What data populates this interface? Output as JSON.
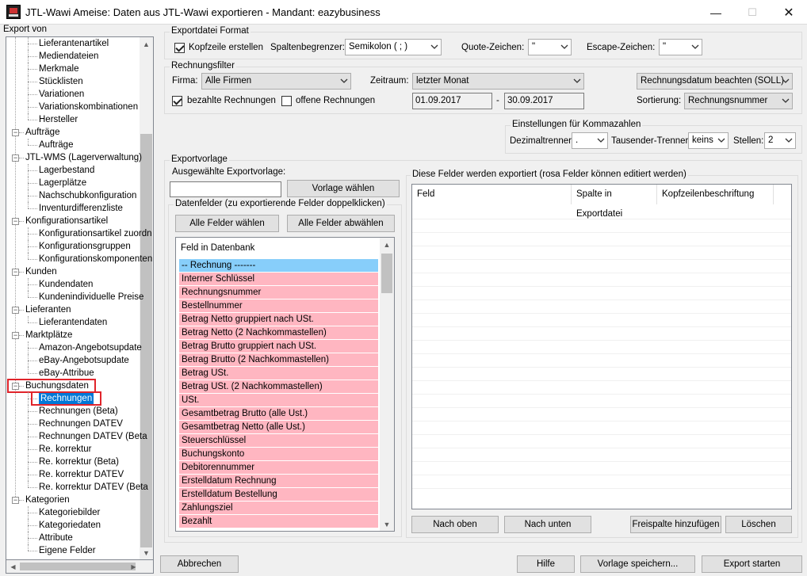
{
  "window": {
    "title": "JTL-Wawi Ameise: Daten aus JTL-Wawi exportieren - Mandant: eazybusiness",
    "minimize": "—",
    "maximize": "☐",
    "close": "✕"
  },
  "tree": {
    "header": "Export von",
    "rows": [
      {
        "label": "Lieferantenartikel",
        "level": 1
      },
      {
        "label": "Mediendateien",
        "level": 1
      },
      {
        "label": "Merkmale",
        "level": 1
      },
      {
        "label": "Stücklisten",
        "level": 1
      },
      {
        "label": "Variationen",
        "level": 1
      },
      {
        "label": "Variationskombinationen",
        "level": 1
      },
      {
        "label": "Hersteller",
        "level": 1
      },
      {
        "label": "Aufträge",
        "level": 0
      },
      {
        "label": "Aufträge",
        "level": 1
      },
      {
        "label": "JTL-WMS (Lagerverwaltung)",
        "level": 0
      },
      {
        "label": "Lagerbestand",
        "level": 1
      },
      {
        "label": "Lagerplätze",
        "level": 1
      },
      {
        "label": "Nachschubkonfiguration",
        "level": 1
      },
      {
        "label": "Inventurdifferenzliste",
        "level": 1
      },
      {
        "label": "Konfigurationsartikel",
        "level": 0
      },
      {
        "label": "Konfigurationsartikel zuordn",
        "level": 1
      },
      {
        "label": "Konfigurationsgruppen",
        "level": 1
      },
      {
        "label": "Konfigurationskomponenten",
        "level": 1
      },
      {
        "label": "Kunden",
        "level": 0
      },
      {
        "label": "Kundendaten",
        "level": 1
      },
      {
        "label": "Kundenindividuelle Preise",
        "level": 1
      },
      {
        "label": "Lieferanten",
        "level": 0
      },
      {
        "label": "Lieferantendaten",
        "level": 1
      },
      {
        "label": "Marktplätze",
        "level": 0
      },
      {
        "label": "Amazon-Angebotsupdate",
        "level": 1
      },
      {
        "label": "eBay-Angebotsupdate",
        "level": 1
      },
      {
        "label": "eBay-Attribue",
        "level": 1
      },
      {
        "label": "Buchungsdaten",
        "level": 0
      },
      {
        "label": "Rechnungen",
        "level": 1,
        "selected": true
      },
      {
        "label": "Rechnungen (Beta)",
        "level": 1
      },
      {
        "label": "Rechnungen DATEV",
        "level": 1
      },
      {
        "label": "Rechnungen DATEV (Beta",
        "level": 1
      },
      {
        "label": "Re. korrektur",
        "level": 1
      },
      {
        "label": "Re. korrektur (Beta)",
        "level": 1
      },
      {
        "label": "Re. korrektur DATEV",
        "level": 1
      },
      {
        "label": "Re. korrektur DATEV (Beta",
        "level": 1
      },
      {
        "label": "Kategorien",
        "level": 0
      },
      {
        "label": "Kategoriebilder",
        "level": 1
      },
      {
        "label": "Kategoriedaten",
        "level": 1
      },
      {
        "label": "Attribute",
        "level": 1
      },
      {
        "label": "Eigene Felder",
        "level": 1
      }
    ]
  },
  "format": {
    "group_label": "Exportdatei Format",
    "header_row_label": "Kopfzeile erstellen",
    "header_row_checked": true,
    "separator_label": "Spaltenbegrenzer:",
    "separator_value": "Semikolon ( ; )",
    "quote_label": "Quote-Zeichen:",
    "quote_value": "\"",
    "escape_label": "Escape-Zeichen:",
    "escape_value": "\""
  },
  "filter": {
    "group_label": "Rechnungsfilter",
    "company_label": "Firma:",
    "company_value": "Alle Firmen",
    "period_label": "Zeitraum:",
    "period_value": "letzter Monat",
    "date_mode_value": "Rechnungsdatum beachten (SOLL)",
    "paid_label": "bezahlte Rechnungen",
    "paid_checked": true,
    "open_label": "offene Rechnungen",
    "open_checked": false,
    "date_from": "01.09.2017",
    "date_dash": "-",
    "date_to": "30.09.2017",
    "sort_label": "Sortierung:",
    "sort_value": "Rechnungsnummer"
  },
  "decimal": {
    "group_label": "Einstellungen für Kommazahlen",
    "decimal_sep_label": "Dezimaltrenner:",
    "decimal_sep_value": ".",
    "thousands_label": "Tausender-Trenner:",
    "thousands_value": "keins",
    "places_label": "Stellen:",
    "places_value": "2"
  },
  "template": {
    "group_label": "Exportvorlage",
    "selected_label": "Ausgewählte Exportvorlage:",
    "selected_value": "",
    "choose_button": "Vorlage wählen"
  },
  "datafields": {
    "group_label": "Datenfelder (zu exportierende Felder doppelklicken)",
    "select_all": "Alle Felder wählen",
    "deselect_all": "Alle Felder abwählen",
    "list_header": "Feld in Datenbank",
    "items": [
      {
        "label": "-- Rechnung -------",
        "style": "blue"
      },
      {
        "label": "Interner Schlüssel",
        "style": "pink"
      },
      {
        "label": "Rechnungsnummer",
        "style": "pink"
      },
      {
        "label": "Bestellnummer",
        "style": "pink"
      },
      {
        "label": "Betrag Netto gruppiert nach USt.",
        "style": "pink"
      },
      {
        "label": "Betrag Netto (2 Nachkommastellen)",
        "style": "pink"
      },
      {
        "label": "Betrag Brutto gruppiert nach USt.",
        "style": "pink"
      },
      {
        "label": "Betrag Brutto (2 Nachkommastellen)",
        "style": "pink"
      },
      {
        "label": "Betrag USt.",
        "style": "pink"
      },
      {
        "label": "Betrag USt. (2 Nachkommastellen)",
        "style": "pink"
      },
      {
        "label": "USt.",
        "style": "pink"
      },
      {
        "label": "Gesamtbetrag Brutto (alle Ust.)",
        "style": "pink"
      },
      {
        "label": "Gesamtbetrag Netto (alle Ust.)",
        "style": "pink"
      },
      {
        "label": "Steuerschlüssel",
        "style": "pink"
      },
      {
        "label": "Buchungskonto",
        "style": "pink"
      },
      {
        "label": "Debitorennummer",
        "style": "pink"
      },
      {
        "label": "Erstelldatum Rechnung",
        "style": "pink"
      },
      {
        "label": "Erstelldatum Bestellung",
        "style": "pink"
      },
      {
        "label": "Zahlungsziel",
        "style": "pink"
      },
      {
        "label": "Bezahlt",
        "style": "pink"
      }
    ]
  },
  "exported": {
    "group_label": "Diese Felder werden exportiert (rosa Felder können editiert werden)",
    "columns": [
      "Feld",
      "Spalte in Exportdatei",
      "Kopfzeilenbeschriftung"
    ],
    "move_up": "Nach oben",
    "move_down": "Nach unten",
    "add_free": "Freispalte hinzufügen",
    "delete": "Löschen"
  },
  "footer": {
    "cancel": "Abbrechen",
    "help": "Hilfe",
    "save_template": "Vorlage speichern...",
    "start_export": "Export starten"
  }
}
